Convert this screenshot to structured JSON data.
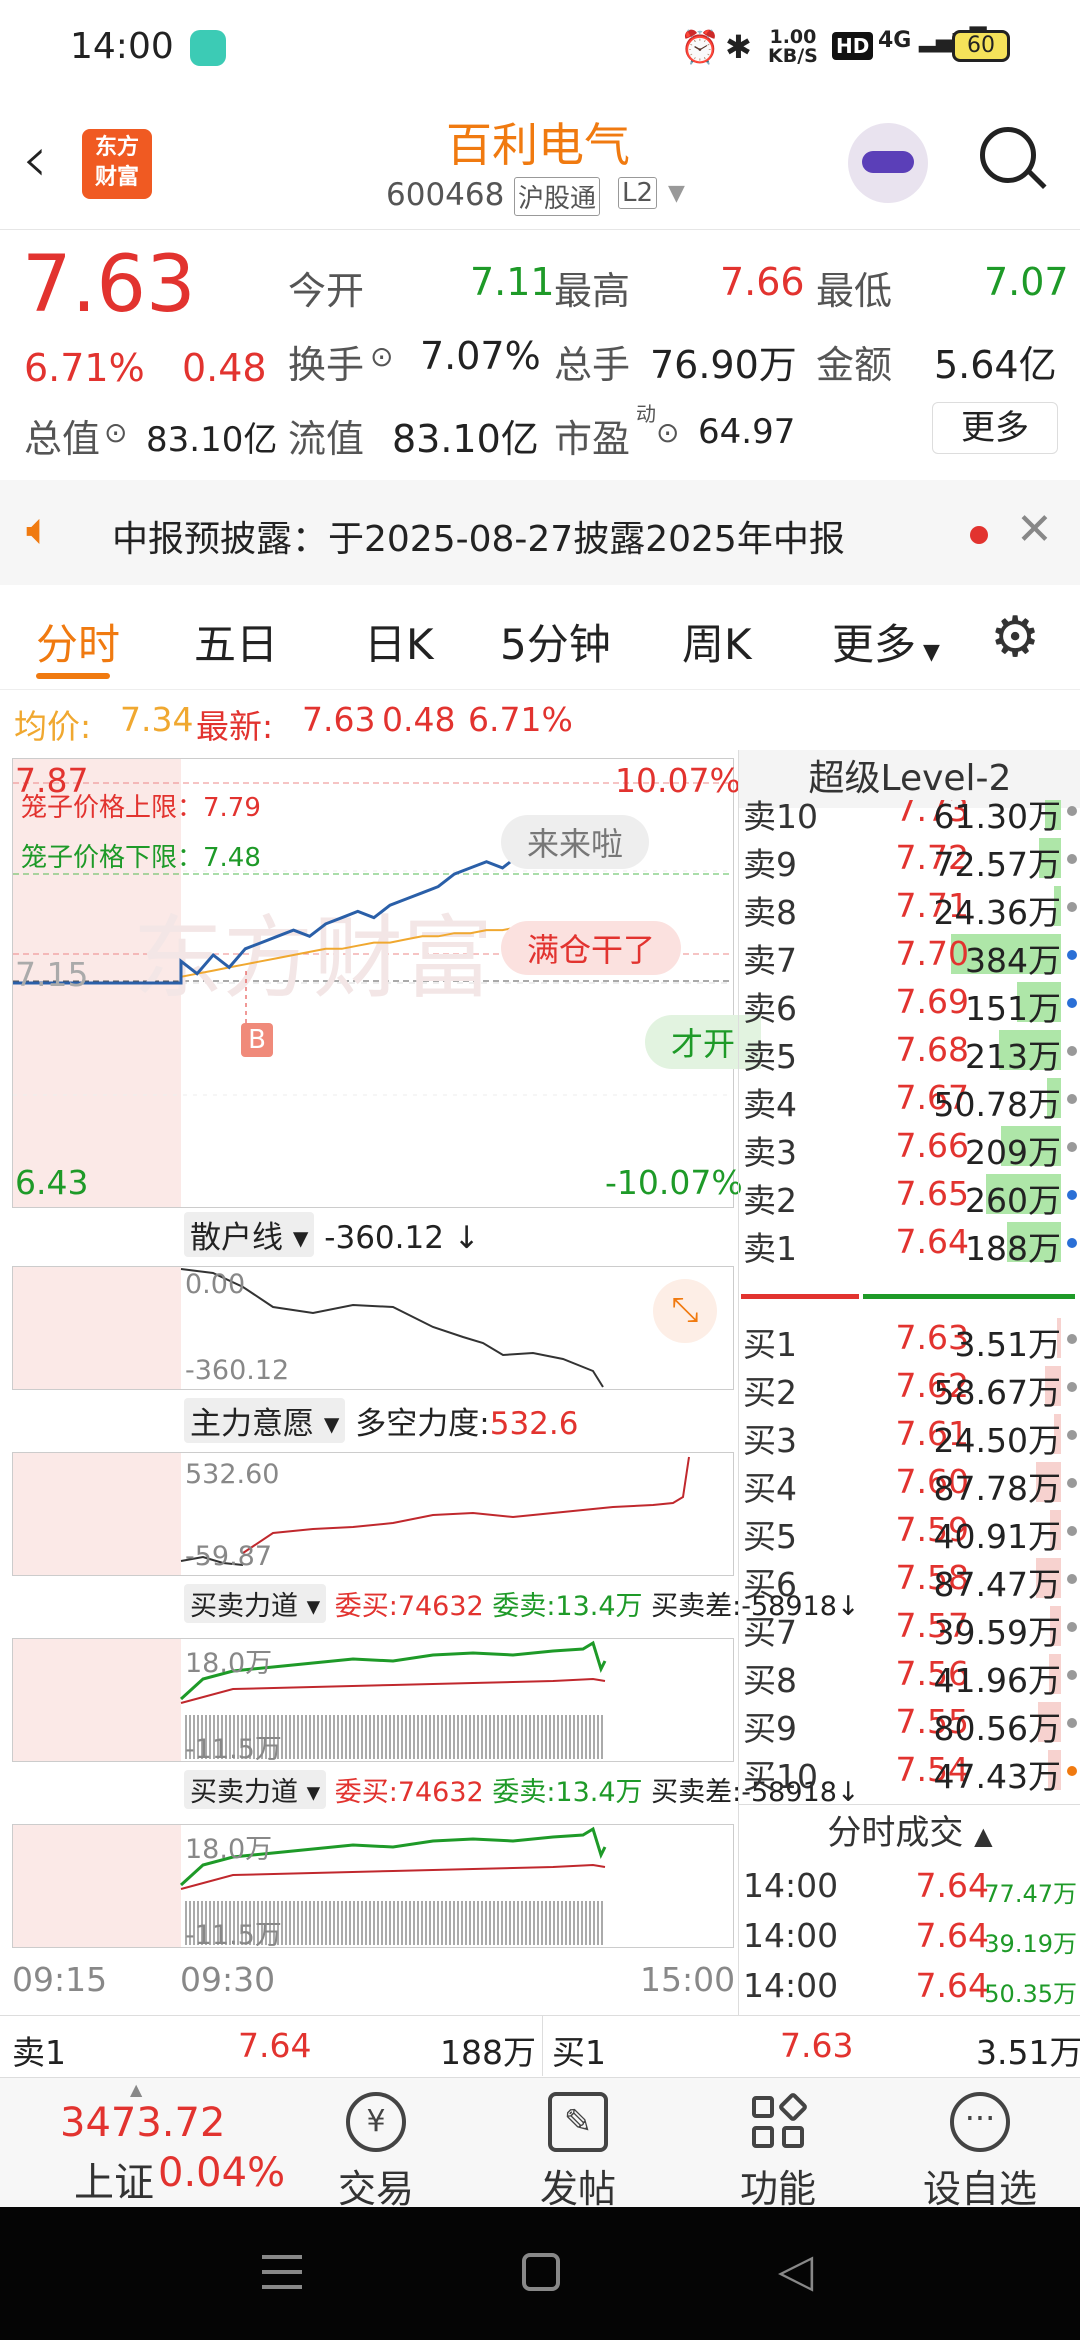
{
  "status_bar": {
    "time": "14:00",
    "net_speed": "1.00\nKB/S",
    "net_speed_top": "1.00",
    "net_speed_bottom": "KB/S",
    "hd": "HD",
    "signal": "4G",
    "battery": "60"
  },
  "header": {
    "brand_line1": "东方",
    "brand_line2": "财富",
    "stock_name": "百利电气",
    "stock_code": "600468",
    "tag_hgt": "沪股通",
    "tag_l2": "L2"
  },
  "quote": {
    "price": "7.63",
    "change_pct": "6.71%",
    "change_amt": "0.48",
    "open_label": "今开",
    "open": "7.11",
    "high_label": "最高",
    "high": "7.66",
    "low_label": "最低",
    "low": "7.07",
    "turnover_label": "换手",
    "turnover": "7.07%",
    "volume_label": "总手",
    "volume": "76.90万",
    "amount_label": "金额",
    "amount": "5.64亿",
    "mcap_label": "总值",
    "mcap": "83.10亿",
    "float_label": "流值",
    "float_mcap": "83.10亿",
    "pe_label": "市盈",
    "pe_sup": "动",
    "pe": "64.97",
    "more_button": "更多"
  },
  "notice": {
    "text": "中报预披露：于2025-08-27披露2025年中报"
  },
  "tabs": [
    "分时",
    "五日",
    "日K",
    "5分钟",
    "周K",
    "更多"
  ],
  "avg_line": {
    "avg_label": "均价:",
    "avg_value": "7.34",
    "latest_label": "最新:",
    "latest": "7.63",
    "chg": "0.48",
    "pct": "6.71%"
  },
  "main_chart": {
    "y_top": "7.87",
    "y_mid": "7.15",
    "y_bottom": "6.43",
    "pct_top": "10.07%",
    "pct_bottom": "-10.07%",
    "cage_upper": "笼子价格上限：7.79",
    "cage_lower": "笼子价格下限：7.48",
    "bubble1": "来来啦",
    "bubble2": "满仓干了",
    "bubble3": "才开",
    "buy_marker": "B",
    "watermark": "东方财富"
  },
  "chart_data": {
    "type": "line",
    "ylim": [
      6.43,
      7.87
    ],
    "series": [
      {
        "name": "价格",
        "values": [
          7.15,
          7.15,
          7.15,
          7.15,
          7.15,
          7.15,
          7.22,
          7.18,
          7.24,
          7.2,
          7.26,
          7.28,
          7.3,
          7.32,
          7.3,
          7.34,
          7.36,
          7.38,
          7.36,
          7.4,
          7.42,
          7.44,
          7.46,
          7.5,
          7.52,
          7.54,
          7.52,
          7.56,
          7.55,
          7.58,
          7.56,
          7.6,
          7.63
        ]
      },
      {
        "name": "均价",
        "values": [
          7.15,
          7.15,
          7.15,
          7.15,
          7.15,
          7.15,
          7.17,
          7.18,
          7.19,
          7.2,
          7.21,
          7.22,
          7.23,
          7.24,
          7.25,
          7.26,
          7.26,
          7.27,
          7.28,
          7.28,
          7.29,
          7.3,
          7.3,
          7.31,
          7.31,
          7.32,
          7.32,
          7.33,
          7.33,
          7.33,
          7.34,
          7.34,
          7.34
        ]
      }
    ]
  },
  "sub1": {
    "selector": "散户线",
    "value": "-360.12",
    "arrow": "↓",
    "top": "0.00",
    "bottom": "-360.12"
  },
  "sub2": {
    "selector": "主力意愿",
    "label": "多空力度:",
    "value": "532.6",
    "top": "532.60",
    "bottom": "-59.87"
  },
  "sub3": {
    "selector": "买卖力道",
    "buy": "委买:74632",
    "sell": "委卖:13.4万",
    "diff": "买卖差:-58918",
    "arrow": "↓",
    "top": "18.0万",
    "bottom": "-11.5万"
  },
  "sub4": {
    "selector": "买卖力道",
    "buy": "委买:74632",
    "sell": "委卖:13.4万",
    "diff": "买卖差:-58918",
    "arrow": "↓",
    "top": "18.0万",
    "bottom": "-11.5万"
  },
  "time_axis": [
    "09:15",
    "09:30",
    "15:00"
  ],
  "orderbook": {
    "title": "超级Level-2",
    "asks": [
      {
        "label": "卖10",
        "price": "7.73",
        "vol": "61.30万",
        "bar": 0.15,
        "dot": "#999"
      },
      {
        "label": "卖9",
        "price": "7.72",
        "vol": "72.57万",
        "bar": 0.2,
        "dot": "#999"
      },
      {
        "label": "卖8",
        "price": "7.71",
        "vol": "24.36万",
        "bar": 0.06,
        "dot": "#999"
      },
      {
        "label": "卖7",
        "price": "7.70",
        "vol": "384万",
        "bar": 1.0,
        "dot": "#2a6fd6"
      },
      {
        "label": "卖6",
        "price": "7.69",
        "vol": "151万",
        "bar": 0.4,
        "dot": "#2a6fd6"
      },
      {
        "label": "卖5",
        "price": "7.68",
        "vol": "213万",
        "bar": 0.56,
        "dot": "#999"
      },
      {
        "label": "卖4",
        "price": "7.67",
        "vol": "50.78万",
        "bar": 0.13,
        "dot": "#999"
      },
      {
        "label": "卖3",
        "price": "7.66",
        "vol": "209万",
        "bar": 0.55,
        "dot": "#999"
      },
      {
        "label": "卖2",
        "price": "7.65",
        "vol": "260万",
        "bar": 0.68,
        "dot": "#2a6fd6"
      },
      {
        "label": "卖1",
        "price": "7.64",
        "vol": "188万",
        "bar": 0.49,
        "dot": "#2a6fd6"
      }
    ],
    "bids": [
      {
        "label": "买1",
        "price": "7.63",
        "vol": "3.51万",
        "bar": 0.01,
        "dot": "#999"
      },
      {
        "label": "买2",
        "price": "7.62",
        "vol": "58.67万",
        "bar": 0.15,
        "dot": "#999"
      },
      {
        "label": "买3",
        "price": "7.61",
        "vol": "24.50万",
        "bar": 0.06,
        "dot": "#999"
      },
      {
        "label": "买4",
        "price": "7.60",
        "vol": "87.78万",
        "bar": 0.23,
        "dot": "#999"
      },
      {
        "label": "买5",
        "price": "7.59",
        "vol": "40.91万",
        "bar": 0.1,
        "dot": "#999"
      },
      {
        "label": "买6",
        "price": "7.58",
        "vol": "87.47万",
        "bar": 0.23,
        "dot": "#999"
      },
      {
        "label": "买7",
        "price": "7.57",
        "vol": "39.59万",
        "bar": 0.1,
        "dot": "#999"
      },
      {
        "label": "买8",
        "price": "7.56",
        "vol": "41.96万",
        "bar": 0.11,
        "dot": "#999"
      },
      {
        "label": "买9",
        "price": "7.55",
        "vol": "80.56万",
        "bar": 0.21,
        "dot": "#999"
      },
      {
        "label": "买10",
        "price": "7.54",
        "vol": "47.43万",
        "bar": 0.12,
        "dot": "#f07a10"
      }
    ],
    "ticks_title": "分时成交",
    "ticks": [
      {
        "time": "14:00",
        "price": "7.64",
        "vol": "77.47万"
      },
      {
        "time": "14:00",
        "price": "7.64",
        "vol": "39.19万"
      },
      {
        "time": "14:00",
        "price": "7.64",
        "vol": "50.35万"
      }
    ]
  },
  "bottom_quote": {
    "sell_label": "卖1",
    "sell_price": "7.64",
    "sell_vol": "188万",
    "buy_label": "买1",
    "buy_price": "7.63",
    "buy_vol": "3.51万"
  },
  "bottom_nav": {
    "index_value": "3473.72",
    "index_name": "上证",
    "index_pct": "0.04%",
    "items": [
      "交易",
      "发帖",
      "功能",
      "设自选"
    ]
  },
  "colors": {
    "up": "#e2332f",
    "down": "#1e9a28",
    "accent": "#f07a10",
    "price_line": "#2a5fa8",
    "avg_line": "#f0a830"
  }
}
